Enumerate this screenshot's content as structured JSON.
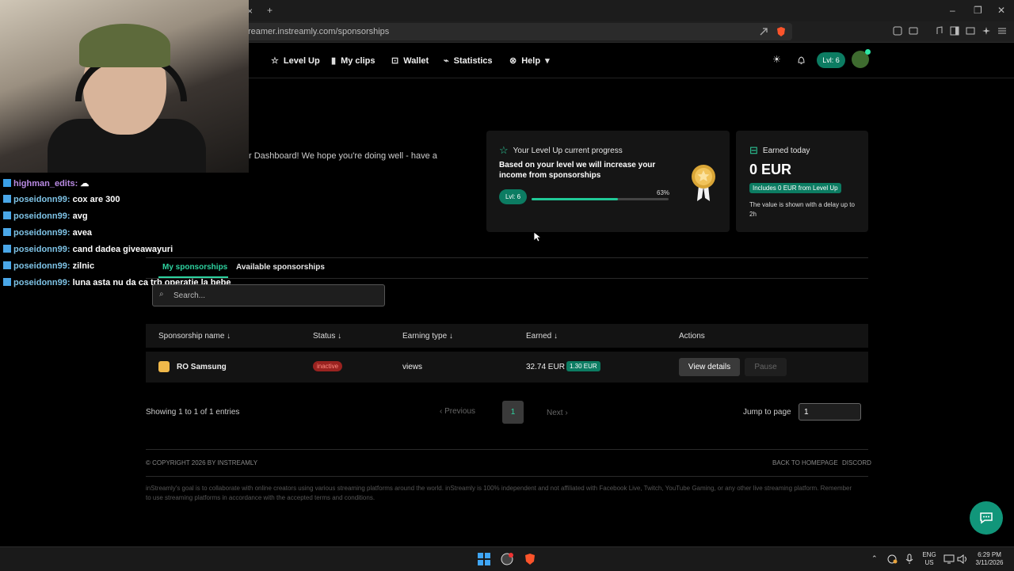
{
  "browser": {
    "url": "reamer.instreamly.com/sponsorships",
    "tab_close": "×",
    "new_tab": "+",
    "window_minimize": "–",
    "window_restore": "❐",
    "window_close": "✕"
  },
  "nav": {
    "items": [
      {
        "label": "Level Up",
        "icon": "star-icon"
      },
      {
        "label": "My clips",
        "icon": "clip-icon"
      },
      {
        "label": "Wallet",
        "icon": "wallet-icon"
      },
      {
        "label": "Statistics",
        "icon": "chart-icon"
      },
      {
        "label": "Help",
        "icon": "help-icon"
      }
    ],
    "level_pill": "Lvl: 6"
  },
  "welcome_text": "r Dashboard! We hope you're doing well - have a",
  "chat": [
    {
      "user": "highman_edits:",
      "message": "☁",
      "color": "purple"
    },
    {
      "user": "poseidonn99:",
      "message": "cox are 300"
    },
    {
      "user": "poseidonn99:",
      "message": "avg"
    },
    {
      "user": "poseidonn99:",
      "message": "avea"
    },
    {
      "user": "poseidonn99:",
      "message": "cand dadea giveawayuri"
    },
    {
      "user": "poseidonn99:",
      "message": "zilnic"
    },
    {
      "user": "poseidonn99:",
      "message": "luna asta nu da ca trb operatie la bebe"
    }
  ],
  "progress_card": {
    "title": "Your Level Up current progress",
    "subtitle": "Based on your level we will increase your income from sponsorships",
    "level": "Lvl: 6",
    "percent_label": "63%",
    "percent": 0.63
  },
  "earned_card": {
    "title": "Earned today",
    "amount": "0 EUR",
    "badge": "Includes 0 EUR from Level Up",
    "note": "The value is shown with a delay up to 2h"
  },
  "tabs": [
    "My sponsorships",
    "Available sponsorships"
  ],
  "search": {
    "placeholder": "Search..."
  },
  "table": {
    "headers": [
      "Sponsorship name ↓",
      "Status ↓",
      "Earning type ↓",
      "Earned ↓",
      "Actions"
    ],
    "rows": [
      {
        "name": "RO Samsung",
        "status": "inactive",
        "earning_type": "views",
        "earned": "32.74 EUR",
        "earned_badge": "1.30 EUR",
        "view": "View details",
        "pause": "Pause"
      }
    ]
  },
  "pagination": {
    "showing": "Showing 1 to 1 of 1 entries",
    "previous": "‹  Previous",
    "current": "1",
    "next": "Next  ›",
    "jump_label": "Jump to page",
    "jump_value": "1"
  },
  "footer": {
    "copyright": "© COPYRIGHT 2026 BY INSTREAMLY",
    "back": "BACK TO HOMEPAGE",
    "discord": "DISCORD",
    "small": "inStreamly's goal is to collaborate with online creators using various streaming platforms around the world. inStreamly is 100% independent and not affiliated with Facebook Live, Twitch, YouTube Gaming, or any other live streaming platform. Remember to use streaming platforms in accordance with the accepted terms and conditions."
  },
  "taskbar": {
    "lang_top": "ENG",
    "lang_bottom": "US",
    "time": "6:29 PM",
    "date": "3/11/2026"
  }
}
